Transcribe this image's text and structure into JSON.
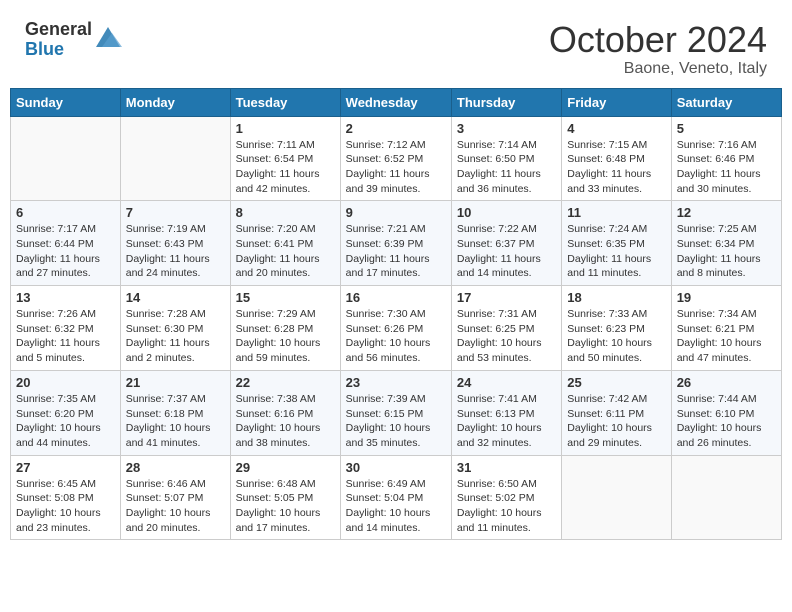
{
  "header": {
    "logo": {
      "general": "General",
      "blue": "Blue"
    },
    "title": "October 2024",
    "location": "Baone, Veneto, Italy"
  },
  "days_of_week": [
    "Sunday",
    "Monday",
    "Tuesday",
    "Wednesday",
    "Thursday",
    "Friday",
    "Saturday"
  ],
  "weeks": [
    [
      {
        "day": "",
        "info": ""
      },
      {
        "day": "",
        "info": ""
      },
      {
        "day": "1",
        "info": "Sunrise: 7:11 AM\nSunset: 6:54 PM\nDaylight: 11 hours and 42 minutes."
      },
      {
        "day": "2",
        "info": "Sunrise: 7:12 AM\nSunset: 6:52 PM\nDaylight: 11 hours and 39 minutes."
      },
      {
        "day": "3",
        "info": "Sunrise: 7:14 AM\nSunset: 6:50 PM\nDaylight: 11 hours and 36 minutes."
      },
      {
        "day": "4",
        "info": "Sunrise: 7:15 AM\nSunset: 6:48 PM\nDaylight: 11 hours and 33 minutes."
      },
      {
        "day": "5",
        "info": "Sunrise: 7:16 AM\nSunset: 6:46 PM\nDaylight: 11 hours and 30 minutes."
      }
    ],
    [
      {
        "day": "6",
        "info": "Sunrise: 7:17 AM\nSunset: 6:44 PM\nDaylight: 11 hours and 27 minutes."
      },
      {
        "day": "7",
        "info": "Sunrise: 7:19 AM\nSunset: 6:43 PM\nDaylight: 11 hours and 24 minutes."
      },
      {
        "day": "8",
        "info": "Sunrise: 7:20 AM\nSunset: 6:41 PM\nDaylight: 11 hours and 20 minutes."
      },
      {
        "day": "9",
        "info": "Sunrise: 7:21 AM\nSunset: 6:39 PM\nDaylight: 11 hours and 17 minutes."
      },
      {
        "day": "10",
        "info": "Sunrise: 7:22 AM\nSunset: 6:37 PM\nDaylight: 11 hours and 14 minutes."
      },
      {
        "day": "11",
        "info": "Sunrise: 7:24 AM\nSunset: 6:35 PM\nDaylight: 11 hours and 11 minutes."
      },
      {
        "day": "12",
        "info": "Sunrise: 7:25 AM\nSunset: 6:34 PM\nDaylight: 11 hours and 8 minutes."
      }
    ],
    [
      {
        "day": "13",
        "info": "Sunrise: 7:26 AM\nSunset: 6:32 PM\nDaylight: 11 hours and 5 minutes."
      },
      {
        "day": "14",
        "info": "Sunrise: 7:28 AM\nSunset: 6:30 PM\nDaylight: 11 hours and 2 minutes."
      },
      {
        "day": "15",
        "info": "Sunrise: 7:29 AM\nSunset: 6:28 PM\nDaylight: 10 hours and 59 minutes."
      },
      {
        "day": "16",
        "info": "Sunrise: 7:30 AM\nSunset: 6:26 PM\nDaylight: 10 hours and 56 minutes."
      },
      {
        "day": "17",
        "info": "Sunrise: 7:31 AM\nSunset: 6:25 PM\nDaylight: 10 hours and 53 minutes."
      },
      {
        "day": "18",
        "info": "Sunrise: 7:33 AM\nSunset: 6:23 PM\nDaylight: 10 hours and 50 minutes."
      },
      {
        "day": "19",
        "info": "Sunrise: 7:34 AM\nSunset: 6:21 PM\nDaylight: 10 hours and 47 minutes."
      }
    ],
    [
      {
        "day": "20",
        "info": "Sunrise: 7:35 AM\nSunset: 6:20 PM\nDaylight: 10 hours and 44 minutes."
      },
      {
        "day": "21",
        "info": "Sunrise: 7:37 AM\nSunset: 6:18 PM\nDaylight: 10 hours and 41 minutes."
      },
      {
        "day": "22",
        "info": "Sunrise: 7:38 AM\nSunset: 6:16 PM\nDaylight: 10 hours and 38 minutes."
      },
      {
        "day": "23",
        "info": "Sunrise: 7:39 AM\nSunset: 6:15 PM\nDaylight: 10 hours and 35 minutes."
      },
      {
        "day": "24",
        "info": "Sunrise: 7:41 AM\nSunset: 6:13 PM\nDaylight: 10 hours and 32 minutes."
      },
      {
        "day": "25",
        "info": "Sunrise: 7:42 AM\nSunset: 6:11 PM\nDaylight: 10 hours and 29 minutes."
      },
      {
        "day": "26",
        "info": "Sunrise: 7:44 AM\nSunset: 6:10 PM\nDaylight: 10 hours and 26 minutes."
      }
    ],
    [
      {
        "day": "27",
        "info": "Sunrise: 6:45 AM\nSunset: 5:08 PM\nDaylight: 10 hours and 23 minutes."
      },
      {
        "day": "28",
        "info": "Sunrise: 6:46 AM\nSunset: 5:07 PM\nDaylight: 10 hours and 20 minutes."
      },
      {
        "day": "29",
        "info": "Sunrise: 6:48 AM\nSunset: 5:05 PM\nDaylight: 10 hours and 17 minutes."
      },
      {
        "day": "30",
        "info": "Sunrise: 6:49 AM\nSunset: 5:04 PM\nDaylight: 10 hours and 14 minutes."
      },
      {
        "day": "31",
        "info": "Sunrise: 6:50 AM\nSunset: 5:02 PM\nDaylight: 10 hours and 11 minutes."
      },
      {
        "day": "",
        "info": ""
      },
      {
        "day": "",
        "info": ""
      }
    ]
  ]
}
